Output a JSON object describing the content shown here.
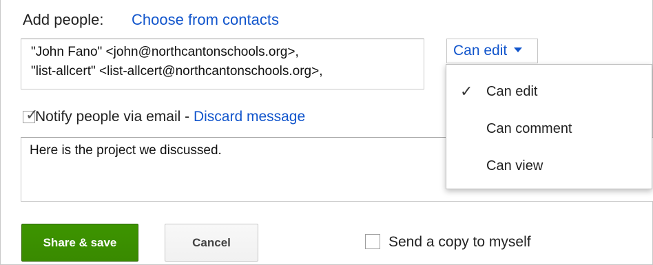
{
  "header": {
    "add_people_label": "Add people:",
    "choose_contacts_link": "Choose from contacts"
  },
  "recipients": [
    "\"John Fano\" <john@northcantonschools.org>,",
    "\"list-allcert\" <list-allcert@northcantonschools.org>,"
  ],
  "permission": {
    "selected": "Can edit",
    "options": [
      {
        "label": "Can edit",
        "checked": true
      },
      {
        "label": "Can comment",
        "checked": false
      },
      {
        "label": "Can view",
        "checked": false
      }
    ]
  },
  "notify": {
    "checked": true,
    "label": "Notify people via email - ",
    "discard_link": "Discard message"
  },
  "message": {
    "text": "Here is the project we discussed."
  },
  "actions": {
    "share_label": "Share & save",
    "cancel_label": "Cancel",
    "send_copy_label": "Send a copy to myself",
    "send_copy_checked": false
  },
  "colors": {
    "link": "#1155cc",
    "share_button": "#3d9400"
  },
  "icons": {
    "dropdown_caret": "chevron-down-icon",
    "checkmark": "check-icon"
  }
}
